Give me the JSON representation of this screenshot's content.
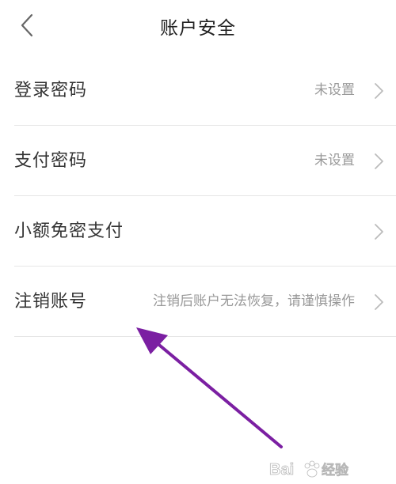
{
  "header": {
    "title": "账户安全",
    "back_icon": "chevron-left-icon"
  },
  "settings": {
    "items": [
      {
        "label": "登录密码",
        "value": "未设置",
        "icon": "chevron-right-icon"
      },
      {
        "label": "支付密码",
        "value": "未设置",
        "icon": "chevron-right-icon"
      },
      {
        "label": "小额免密支付",
        "value": "",
        "icon": "chevron-right-icon"
      },
      {
        "label": "注销账号",
        "value": "注销后账户无法恢复，请谨慎操作",
        "icon": "chevron-right-icon"
      }
    ]
  },
  "annotation": {
    "arrow_color": "#7b1fa2",
    "icon": "pointer-arrow-icon"
  },
  "watermark": {
    "brand": "Bai",
    "suffix": "经验",
    "icon": "baidu-paw-icon"
  }
}
